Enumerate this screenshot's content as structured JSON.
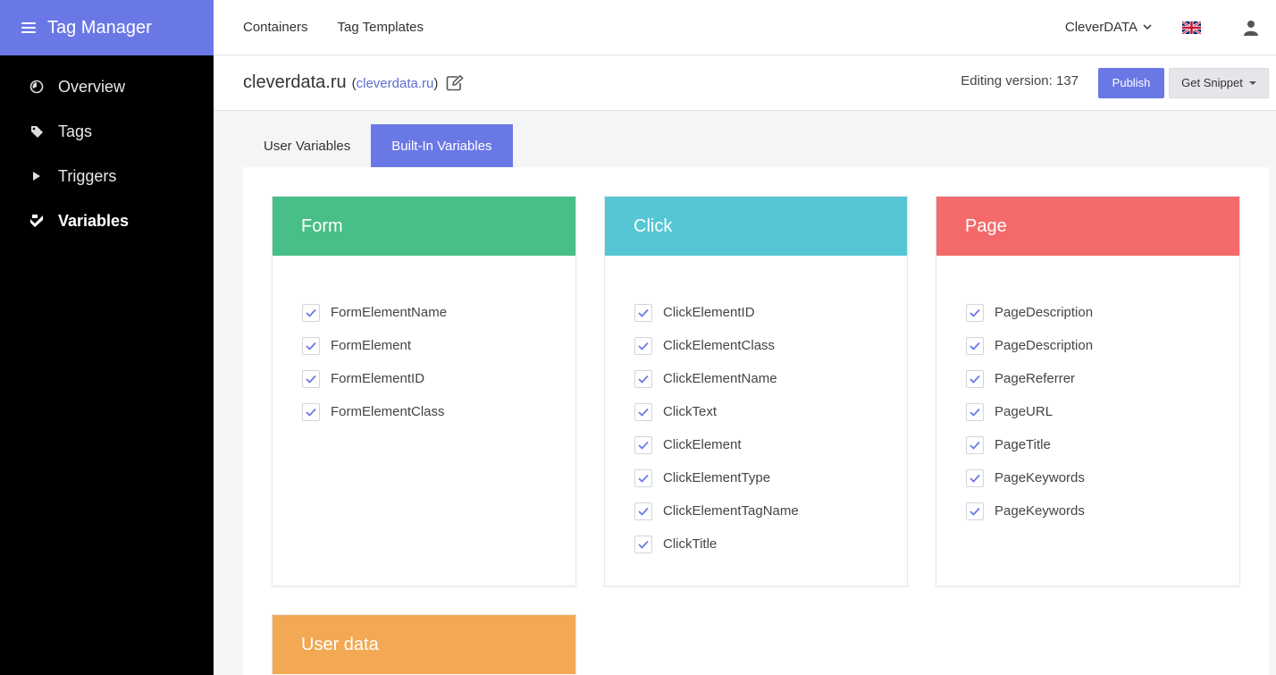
{
  "app": {
    "title": "Tag Manager"
  },
  "sidebar": {
    "items": [
      {
        "label": "Overview",
        "icon": "overview-icon"
      },
      {
        "label": "Tags",
        "icon": "tag-icon"
      },
      {
        "label": "Triggers",
        "icon": "play-icon"
      },
      {
        "label": "Variables",
        "icon": "variables-icon",
        "active": true
      }
    ]
  },
  "topnav": {
    "containers": "Containers",
    "tag_templates": "Tag Templates"
  },
  "account": {
    "name": "CleverDATA",
    "flag": "uk-flag-icon",
    "user": "user-icon"
  },
  "container": {
    "name": "cleverdata.ru",
    "domain": "cleverdata.ru"
  },
  "version": {
    "label": "Editing version: 137"
  },
  "buttons": {
    "publish": "Publish",
    "snippet": "Get Snippet"
  },
  "tabs": [
    {
      "label": "User Variables",
      "active": false
    },
    {
      "label": "Built-In Variables",
      "active": true
    }
  ],
  "colors": {
    "accent": "#6a78e6",
    "form": "#47bf86",
    "click": "#55c7d4",
    "page": "#f46a6a",
    "user_data": "#f3a853"
  },
  "cards": [
    {
      "title": "Form",
      "items": [
        "FormElementName",
        "FormElement",
        "FormElementID",
        "FormElementClass"
      ]
    },
    {
      "title": "Click",
      "items": [
        "ClickElementID",
        "ClickElementClass",
        "ClickElementName",
        "ClickText",
        "ClickElement",
        "ClickElementType",
        "ClickElementTagName",
        "ClickTitle"
      ]
    },
    {
      "title": "Page",
      "items": [
        "PageDescription",
        "PageDescription",
        "PageReferrer",
        "PageURL",
        "PageTitle",
        "PageKeywords",
        "PageKeywords"
      ]
    },
    {
      "title": "User data",
      "items": []
    }
  ]
}
